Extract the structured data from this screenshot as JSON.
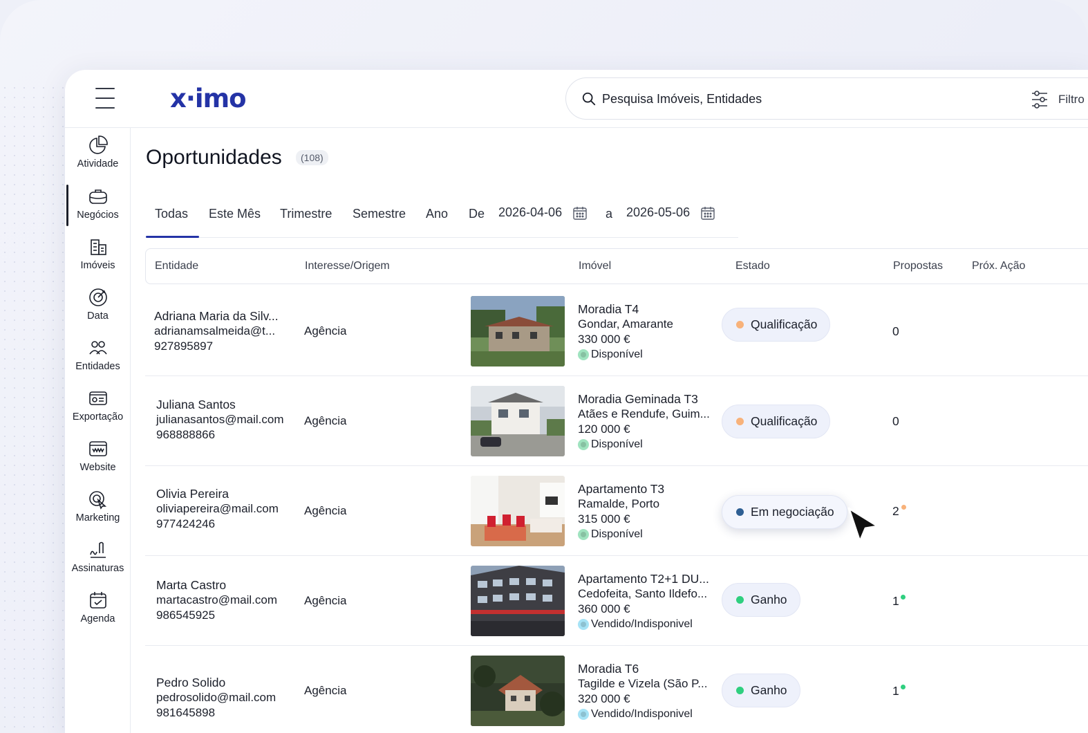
{
  "brand": {
    "logo": "x·imo",
    "accent": "#2433a6"
  },
  "search": {
    "placeholder": "Pesquisa Imóveis, Entidades",
    "filter_label": "Filtro"
  },
  "sidebar": {
    "items": [
      {
        "label": "Atividade",
        "icon": "pie-chart-icon"
      },
      {
        "label": "Negócios",
        "icon": "briefcase-icon",
        "active": true
      },
      {
        "label": "Imóveis",
        "icon": "building-icon"
      },
      {
        "label": "Data",
        "icon": "target-icon"
      },
      {
        "label": "Entidades",
        "icon": "users-icon"
      },
      {
        "label": "Exportação",
        "icon": "export-card-icon"
      },
      {
        "label": "Website",
        "icon": "website-icon"
      },
      {
        "label": "Marketing",
        "icon": "marketing-icon"
      },
      {
        "label": "Assinaturas",
        "icon": "signature-icon"
      },
      {
        "label": "Agenda",
        "icon": "calendar-check-icon"
      }
    ]
  },
  "page": {
    "title": "Oportunidades",
    "count": "(108)"
  },
  "tabs": {
    "items": [
      "Todas",
      "Este Mês",
      "Trimestre",
      "Semestre",
      "Ano"
    ],
    "active": "Todas",
    "from_label": "De",
    "from_date": "2026-04-06",
    "to_label": "a",
    "to_date": "2026-05-06"
  },
  "table": {
    "headers": [
      "Entidade",
      "Interesse/Origem",
      "Imóvel",
      "Estado",
      "Propostas",
      "Próx. Ação"
    ],
    "rows": [
      {
        "name": "Adriana Maria da Silv...",
        "email": "adrianamsalmeida@t...",
        "phone": "927895897",
        "origin": "Agência",
        "property_title": "Moradia T4",
        "property_location": "Gondar, Amarante",
        "property_price": "330 000 €",
        "property_status": "Disponível",
        "property_status_color": "#34c47c",
        "state": "Qualificação",
        "state_color": "#f8b27a",
        "proposals": "0"
      },
      {
        "name": "Juliana Santos",
        "email": "julianasantos@mail.com",
        "phone": "968888866",
        "origin": "Agência",
        "property_title": "Moradia Geminada T3",
        "property_location": "Atães e Rendufe, Guim...",
        "property_price": "120 000 €",
        "property_status": "Disponível",
        "property_status_color": "#34c47c",
        "state": "Qualificação",
        "state_color": "#f8b27a",
        "proposals": "0"
      },
      {
        "name": "Olivia Pereira",
        "email": "oliviapereira@mail.com",
        "phone": "977424246",
        "origin": "Agência",
        "property_title": "Apartamento T3",
        "property_location": "Ramalde, Porto",
        "property_price": "315 000 €",
        "property_status": "Disponível",
        "property_status_color": "#34c47c",
        "state": "Em negociação",
        "state_color": "#2e5f93",
        "proposals": "2",
        "proposal_dot_color": "#f8b27a"
      },
      {
        "name": "Marta Castro",
        "email": "martacastro@mail.com",
        "phone": "986545925",
        "origin": "Agência",
        "property_title": "Apartamento T2+1 DU...",
        "property_location": "Cedofeita, Santo Ildefo...",
        "property_price": "360 000 €",
        "property_status": "Vendido/Indisponivel",
        "property_status_color": "#2fb8e8",
        "state": "Ganho",
        "state_color": "#2fcf7f",
        "proposals": "1",
        "proposal_dot_color": "#2fcf7f"
      },
      {
        "name": "Pedro Solido",
        "email": "pedrosolido@mail.com",
        "phone": "981645898",
        "origin": "Agência",
        "property_title": "Moradia T6",
        "property_location": "Tagilde e Vizela (São P...",
        "property_price": "320 000 €",
        "property_status": "Vendido/Indisponivel",
        "property_status_color": "#2fb8e8",
        "state": "Ganho",
        "state_color": "#2fcf7f",
        "proposals": "1",
        "proposal_dot_color": "#2fcf7f"
      }
    ]
  }
}
